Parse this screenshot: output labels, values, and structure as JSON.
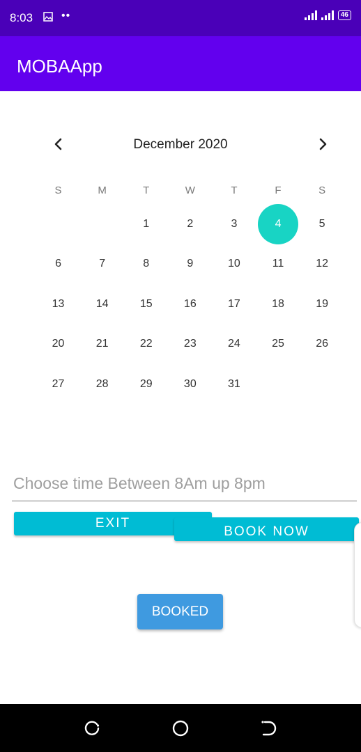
{
  "status_bar": {
    "time": "8:03",
    "dots": "••",
    "battery": "46",
    "icons": [
      "image-icon",
      "signal-icon",
      "signal-icon",
      "battery-icon"
    ]
  },
  "app_bar": {
    "title": "MOBAApp"
  },
  "calendar": {
    "month_label": "December 2020",
    "weekdays": [
      "S",
      "M",
      "T",
      "W",
      "T",
      "F",
      "S"
    ],
    "weeks": [
      [
        "",
        "",
        "1",
        "2",
        "3",
        "4",
        "5"
      ],
      [
        "6",
        "7",
        "8",
        "9",
        "10",
        "11",
        "12"
      ],
      [
        "13",
        "14",
        "15",
        "16",
        "17",
        "18",
        "19"
      ],
      [
        "20",
        "21",
        "22",
        "23",
        "24",
        "25",
        "26"
      ],
      [
        "27",
        "28",
        "29",
        "30",
        "31",
        "",
        ""
      ]
    ],
    "selected_day": "4",
    "selected_color": "#18d4c4",
    "prev_icon": "chevron-left-icon",
    "next_icon": "chevron-right-icon"
  },
  "time_field": {
    "value": "",
    "placeholder": "Choose time Between 8Am up 8pm"
  },
  "buttons": {
    "exit_label": "EXIT",
    "book_label": "BOOK NOW",
    "booked_label": "BOOKED"
  },
  "colors": {
    "status_bar": "#4a00b8",
    "app_bar": "#6200ee",
    "accent_button": "#00bcd4",
    "booked_button": "#3f9ae0"
  },
  "nav_bar": {
    "icons": [
      "recent-apps-icon",
      "home-icon",
      "back-icon"
    ]
  }
}
